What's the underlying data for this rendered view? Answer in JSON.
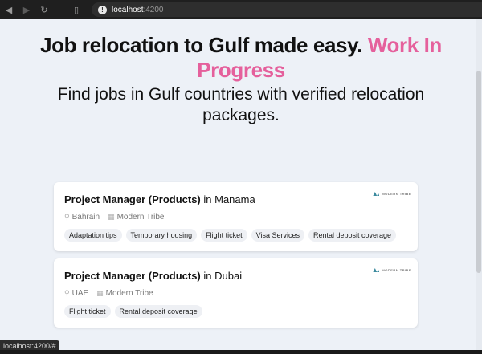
{
  "browser": {
    "url_host": "localhost",
    "url_port": ":4200",
    "status_url": "localhost:4200/#"
  },
  "hero": {
    "title_main": "Job relocation to Gulf made easy. ",
    "title_accent": "Work In Progress",
    "subtitle": "Find jobs in Gulf countries with verified relocation packages."
  },
  "colors": {
    "accent": "#e5609c",
    "page_bg": "#edf1f7"
  },
  "jobs": [
    {
      "title": "Project Manager (Products)",
      "in_word": " in ",
      "city": "Manama",
      "country": "Bahrain",
      "company": "Modern Tribe",
      "logo_text": "MODERN TRIBE",
      "tags": [
        "Adaptation tips",
        "Temporary housing",
        "Flight ticket",
        "Visa Services",
        "Rental deposit coverage"
      ]
    },
    {
      "title": "Project Manager (Products)",
      "in_word": " in ",
      "city": "Dubai",
      "country": "UAE",
      "company": "Modern Tribe",
      "logo_text": "MODERN TRIBE",
      "tags": [
        "Flight ticket",
        "Rental deposit coverage"
      ]
    }
  ]
}
